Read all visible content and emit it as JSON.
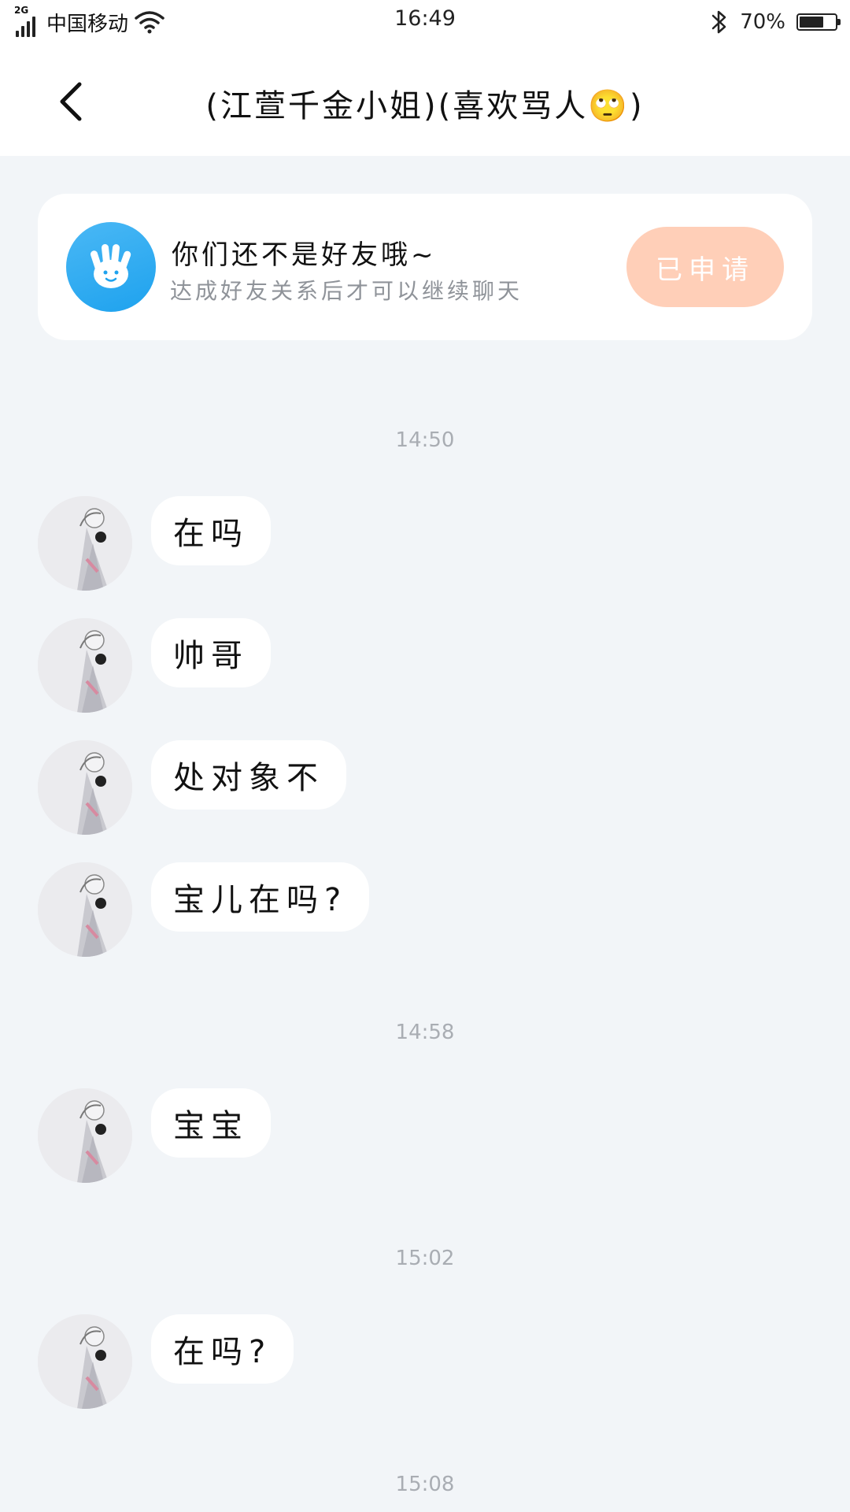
{
  "status_bar": {
    "network": "2G",
    "carrier": "中国移动",
    "time": "16:49",
    "battery_percent": "70%",
    "battery_level": 0.7
  },
  "header": {
    "title": "(江萱千金小姐)(喜欢骂人🙄)"
  },
  "notice": {
    "title": "你们还不是好友哦~",
    "subtitle": "达成好友关系后才可以继续聊天",
    "button_label": "已申请",
    "button_color": "#ffcfb8",
    "icon_color": "#1ea2ee"
  },
  "chat": {
    "timestamps": [
      "14:50",
      "14:58",
      "15:02",
      "15:08"
    ],
    "messages": [
      {
        "text": "在吗"
      },
      {
        "text": "帅哥"
      },
      {
        "text": "处对象不"
      },
      {
        "text": "宝儿在吗?"
      },
      {
        "text": "宝宝"
      },
      {
        "text": "在吗?"
      }
    ]
  }
}
